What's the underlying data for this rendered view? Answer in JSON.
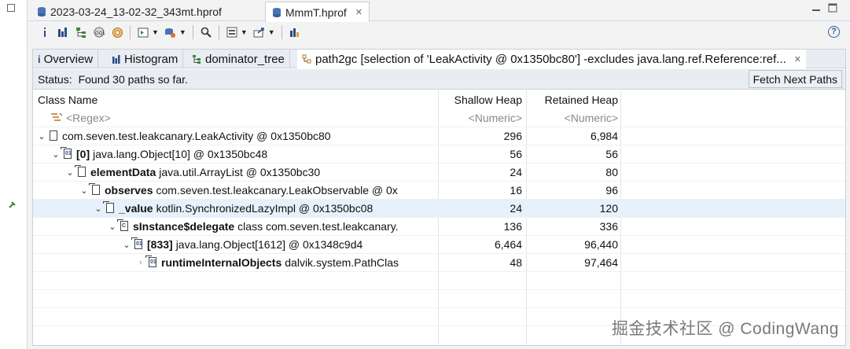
{
  "editor_tabs": [
    {
      "label": "2023-03-24_13-02-32_343mt.hprof",
      "active": false
    },
    {
      "label": "MmmT.hprof",
      "active": true
    }
  ],
  "inner_tabs": {
    "overview": "Overview",
    "histogram": "Histogram",
    "dominator_tree": "dominator_tree",
    "path2gc": "path2gc  [selection of 'LeakActivity @ 0x1350bc80'] -excludes java.lang.ref.Reference:ref..."
  },
  "status": {
    "label": "Status:",
    "text": "Found 30 paths so far.",
    "fetch_button": "Fetch Next Paths"
  },
  "table": {
    "columns": {
      "class_name": "Class Name",
      "shallow": "Shallow Heap",
      "retained": "Retained Heap"
    },
    "filter": {
      "class_name": "<Regex>",
      "shallow": "<Numeric>",
      "retained": "<Numeric>"
    },
    "rows": [
      {
        "field": "",
        "name": "com.seven.test.leakcanary.LeakActivity @ 0x1350bc80",
        "shallow": "296",
        "retained": "6,984"
      },
      {
        "field": "[0]",
        "name": "java.lang.Object[10] @ 0x1350bc48",
        "shallow": "56",
        "retained": "56"
      },
      {
        "field": "elementData",
        "name": "java.util.ArrayList @ 0x1350bc30",
        "shallow": "24",
        "retained": "80"
      },
      {
        "field": "observes",
        "name": "com.seven.test.leakcanary.LeakObservable @ 0x",
        "shallow": "16",
        "retained": "96"
      },
      {
        "field": "_value",
        "name": "kotlin.SynchronizedLazyImpl @ 0x1350bc08",
        "shallow": "24",
        "retained": "120"
      },
      {
        "field": "sInstance$delegate",
        "name": "class com.seven.test.leakcanary.",
        "shallow": "136",
        "retained": "336"
      },
      {
        "field": "[833]",
        "name": "java.lang.Object[1612] @ 0x1348c9d4",
        "shallow": "6,464",
        "retained": "96,440"
      },
      {
        "field": "runtimeInternalObjects",
        "name": "dalvik.system.PathClas",
        "shallow": "48",
        "retained": "97,464"
      }
    ]
  },
  "watermark": "掘金技术社区 @ CodingWang",
  "colors": {
    "accent": "#2a4e86",
    "selection": "#e6f1fb",
    "chrome": "#e9edf2"
  }
}
